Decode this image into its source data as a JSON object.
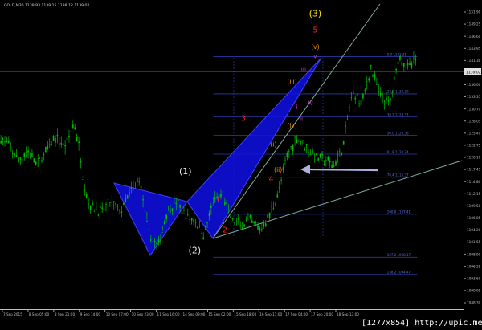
{
  "window": {
    "symbol_header": "GOLD,M30  1138.93  1139.15  1138.12  1139.02"
  },
  "watermark": "[1277x854] http://upic.me/",
  "colors": {
    "background": "#000000",
    "candles": "#00c000",
    "axis": "#bfbfbf",
    "triangle": "#1010ee",
    "triangle_edge": "#4040ff",
    "trend": "#7fae9a",
    "fib": "#2a3aa8",
    "wave_white": "#e6e6e6",
    "wave_red": "#ff2020",
    "wave_yellow": "#ffe000",
    "wave_orange": "#ff8c00",
    "wave_magenta": "#cc33cc",
    "price_line": "#c8c8c8"
  },
  "chart_data": {
    "type": "candlestick",
    "title": "GOLD,M30",
    "header_values": {
      "open": 1138.93,
      "high": 1139.15,
      "low": 1138.12,
      "close": 1139.02
    },
    "current_price": "1139.02",
    "ylim": [
      1087.0,
      1153.5
    ],
    "xlim": [
      0,
      100
    ],
    "y_ticks": [
      "1151.90",
      "1149.25",
      "1146.60",
      "1143.95",
      "1141.30",
      "1138.65",
      "1136.00",
      "1133.35",
      "1130.70",
      "1128.05",
      "1125.40",
      "1122.75",
      "1120.10",
      "1117.45",
      "1114.80",
      "1112.15",
      "1109.50",
      "1106.85",
      "1104.20",
      "1101.55",
      "1098.90",
      "1096.25",
      "1093.60",
      "1090.95",
      "1088.30"
    ],
    "x_ticks": [
      "7 Sep 2015",
      "8 Sep 05:00",
      "8 Sep 21:00",
      "9 Sep 14:00",
      "10 Sep 07:00",
      "10 Sep 23:00",
      "11 Sep 16:00",
      "14 Sep 09:00",
      "15 Sep 02:00",
      "15 Sep 18:00",
      "16 Sep 11:00",
      "17 Sep 04:00",
      "17 Sep 20:00",
      "18 Sep 13:00"
    ],
    "price_path": [
      [
        0,
        1124
      ],
      [
        2,
        1122
      ],
      [
        4,
        1119
      ],
      [
        6,
        1121
      ],
      [
        8,
        1118
      ],
      [
        10,
        1121
      ],
      [
        12,
        1124
      ],
      [
        14,
        1122
      ],
      [
        16,
        1127
      ],
      [
        17,
        1122
      ],
      [
        18,
        1115
      ],
      [
        19,
        1110
      ],
      [
        20,
        1109
      ],
      [
        22,
        1108
      ],
      [
        24,
        1110
      ],
      [
        26,
        1108
      ],
      [
        28,
        1112
      ],
      [
        30,
        1115
      ],
      [
        32,
        1104
      ],
      [
        34,
        1100
      ],
      [
        36,
        1108
      ],
      [
        38,
        1110
      ],
      [
        40,
        1107
      ],
      [
        42,
        1106
      ],
      [
        44,
        1103
      ],
      [
        46,
        1110
      ],
      [
        48,
        1112
      ],
      [
        50,
        1106
      ],
      [
        52,
        1105
      ],
      [
        54,
        1106
      ],
      [
        56,
        1104
      ],
      [
        58,
        1107
      ],
      [
        60,
        1112
      ],
      [
        62,
        1120
      ],
      [
        64,
        1124
      ],
      [
        66,
        1122
      ],
      [
        68,
        1120
      ],
      [
        70,
        1119
      ],
      [
        72,
        1118
      ],
      [
        74,
        1122
      ],
      [
        76,
        1134
      ],
      [
        78,
        1131
      ],
      [
        80,
        1139
      ],
      [
        82,
        1133
      ],
      [
        84,
        1131
      ],
      [
        86,
        1141
      ],
      [
        88,
        1139
      ],
      [
        90,
        1141
      ]
    ],
    "fib_levels": [
      {
        "label": "0.0  1141.31",
        "value": 1141.31
      },
      {
        "label": "23.6  1133.30",
        "value": 1133.3
      },
      {
        "label": "38.2  1128.37",
        "value": 1128.37
      },
      {
        "label": "50.0  1124.36",
        "value": 1124.36
      },
      {
        "label": "61.8  1120.34",
        "value": 1120.34
      },
      {
        "label": "76.4  1115.37",
        "value": 1115.37
      },
      {
        "label": "100.0  1107.41",
        "value": 1107.41
      },
      {
        "label": "127.2  1098.17",
        "value": 1098.17
      },
      {
        "label": "138.2  1094.47",
        "value": 1094.47
      }
    ],
    "wave_labels": [
      {
        "text": "(1)",
        "x": 40,
        "y": 1116,
        "color": "white"
      },
      {
        "text": "(2)",
        "x": 42,
        "y": 1099,
        "color": "white"
      },
      {
        "text": "(3)",
        "x": 68,
        "y": 1150,
        "color": "yellow"
      },
      {
        "text": "5",
        "x": 68,
        "y": 1146.5,
        "color": "red"
      },
      {
        "text": "(v)",
        "x": 68,
        "y": 1143,
        "color": "orange"
      },
      {
        "text": "v",
        "x": 68,
        "y": 1141,
        "color": "magenta"
      },
      {
        "text": "iii",
        "x": 65.5,
        "y": 1138,
        "color": "magenta"
      },
      {
        "text": "(iii)",
        "x": 63,
        "y": 1135.5,
        "color": "orange"
      },
      {
        "text": "iv",
        "x": 67,
        "y": 1131,
        "color": "magenta"
      },
      {
        "text": "ii",
        "x": 65,
        "y": 1127.5,
        "color": "magenta"
      },
      {
        "text": "(iv)",
        "x": 63,
        "y": 1126,
        "color": "orange"
      },
      {
        "text": "i",
        "x": 64,
        "y": 1130,
        "color": "magenta"
      },
      {
        "text": "(i)",
        "x": 59,
        "y": 1122,
        "color": "orange"
      },
      {
        "text": "(ii)",
        "x": 60,
        "y": 1116.5,
        "color": "orange"
      },
      {
        "text": "4",
        "x": 58.5,
        "y": 1114.5,
        "color": "red"
      },
      {
        "text": "3",
        "x": 52.5,
        "y": 1127.5,
        "color": "red"
      },
      {
        "text": "2",
        "x": 48.5,
        "y": 1103.5,
        "color": "red"
      },
      {
        "text": "1",
        "x": 47,
        "y": 1110,
        "color": "red"
      }
    ]
  }
}
